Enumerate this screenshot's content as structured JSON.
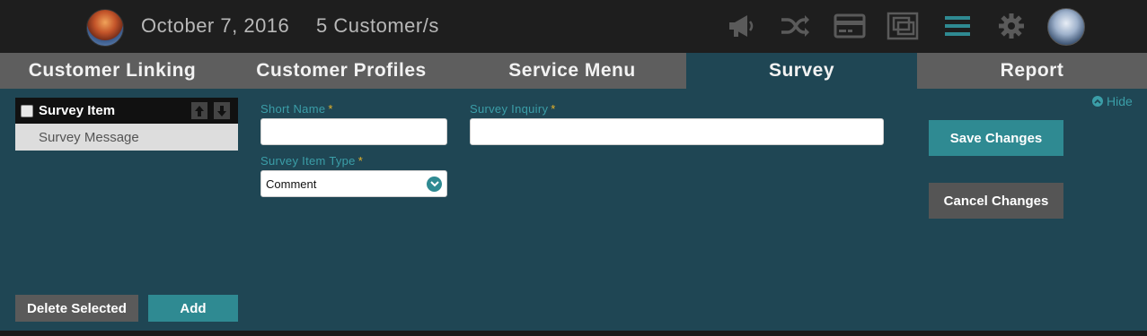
{
  "header": {
    "date": "October 7, 2016",
    "customers": "5 Customer/s",
    "icons": [
      "logo",
      "megaphone-icon",
      "shuffle-icon",
      "credit-card-icon",
      "screens-icon",
      "menu-icon",
      "gear-icon",
      "avatar"
    ],
    "menu_icon_color": "#2f8a92"
  },
  "tabs": [
    {
      "label": "Customer Linking"
    },
    {
      "label": "Customer Profiles"
    },
    {
      "label": "Service Menu"
    },
    {
      "label": "Survey",
      "active": true
    },
    {
      "label": "Report"
    }
  ],
  "list": {
    "header_label": "Survey Item",
    "items": [
      {
        "label": "Survey Message"
      }
    ]
  },
  "buttons": {
    "delete_selected": "Delete Selected",
    "add": "Add",
    "save_changes": "Save Changes",
    "cancel_changes": "Cancel Changes",
    "hide": "Hide"
  },
  "form": {
    "short_name": {
      "label": "Short Name",
      "required_mark": "*",
      "value": ""
    },
    "survey_inquiry": {
      "label": "Survey Inquiry",
      "required_mark": "*",
      "value": ""
    },
    "survey_item_type": {
      "label": "Survey Item Type",
      "required_mark": "*",
      "selected": "Comment"
    }
  },
  "colors": {
    "panel_bg": "#1f4654",
    "accent": "#2f8a92",
    "label": "#3b9ea8",
    "required": "#e6b32a",
    "tab_bar": "#5e5e5e",
    "topbar": "#1e1e1e"
  }
}
